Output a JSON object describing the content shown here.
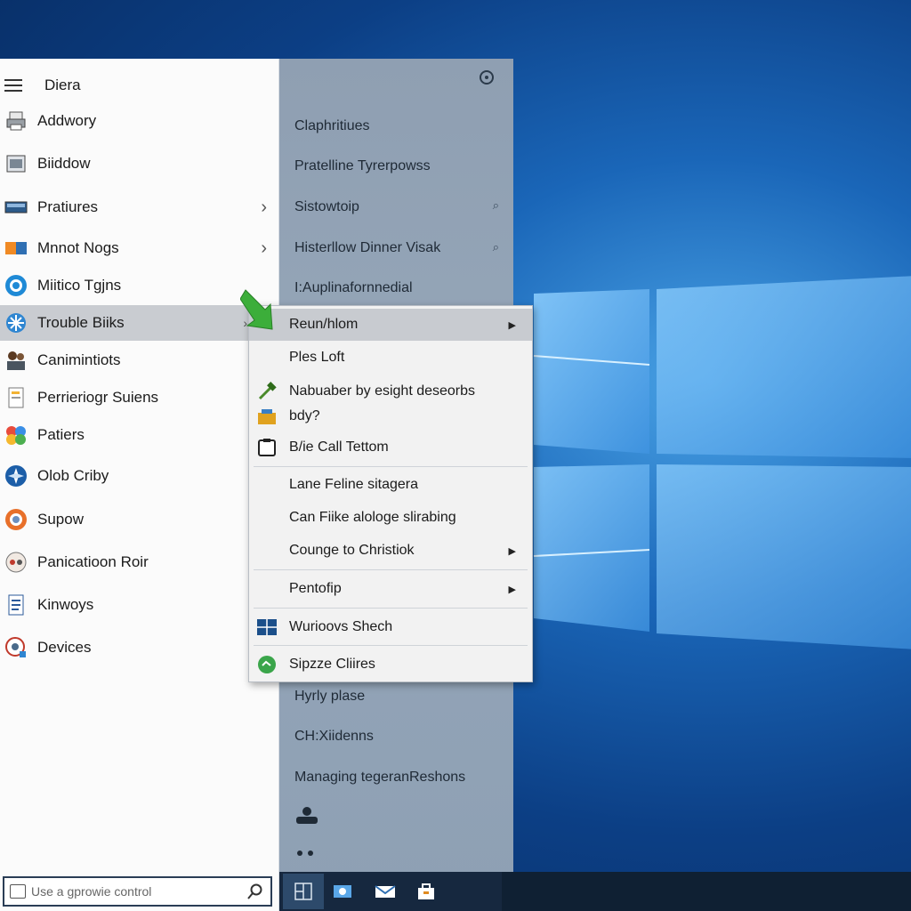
{
  "start_menu": {
    "title": "Diera",
    "items": [
      {
        "label": "Addwory",
        "icon": "printer-icon"
      },
      {
        "label": "Biiddow",
        "icon": "window-icon"
      },
      {
        "label": "Pratiures",
        "icon": "display-icon",
        "chevron": "›"
      },
      {
        "label": "Mnnot Nogs",
        "icon": "folder-icon",
        "chevron": "›"
      },
      {
        "label": "Miitico Tgjns",
        "icon": "globe-icon"
      },
      {
        "label": "Trouble Biiks",
        "icon": "settings-gear-icon",
        "chevron": "›"
      },
      {
        "label": "Canimintiots",
        "icon": "people-icon"
      },
      {
        "label": "Perrieriogr Suiens",
        "icon": "document-icon"
      },
      {
        "label": "Patiers",
        "icon": "shapes-icon"
      },
      {
        "label": "Olob Criby",
        "icon": "compass-icon"
      },
      {
        "label": "Supow",
        "icon": "browser-icon"
      },
      {
        "label": "Panicatioon Roir",
        "icon": "gamepad-icon"
      },
      {
        "label": "Kinwoys",
        "icon": "file-icon"
      },
      {
        "label": "Devices",
        "icon": "devices-icon"
      }
    ]
  },
  "tile_column": {
    "items": [
      {
        "label": "Claphritiues"
      },
      {
        "label": "Pratelline Tyrerpowss"
      },
      {
        "label": "Sistowtoip",
        "pin": "⌕"
      },
      {
        "label": "Histerllow Dinner Visak",
        "pin": "⌕"
      },
      {
        "label": "I:Auplinafornnedial"
      },
      {
        "label": "Hyrly plase"
      },
      {
        "label": "CH:Xiidenns"
      },
      {
        "label": "Managing tegeranReshons"
      }
    ]
  },
  "context_menu": {
    "items": [
      {
        "label": "Reun/hlom",
        "arrow": "▶"
      },
      {
        "label": "Ples Loft"
      },
      {
        "label": "Nabuaber by esight deseorbs"
      },
      {
        "label": "bdy?"
      },
      {
        "label": "B/ie Call Tettom"
      },
      {
        "label": "Lane Feline sitagera"
      },
      {
        "label": "Can Fiike alologe slirabing"
      },
      {
        "label": "Counge to Christiok",
        "arrow": "▶"
      },
      {
        "label": "Pentofip",
        "arrow": "▶"
      },
      {
        "label": "Wurioovs Shech"
      },
      {
        "label": "Sipzze Cliires"
      }
    ]
  },
  "search": {
    "placeholder": "Use a gprowie control"
  },
  "taskbar": {
    "icons": [
      "start-icon",
      "photos-icon",
      "mail-icon",
      "store-icon"
    ]
  },
  "colors": {
    "accent": "#1a66b8",
    "panel": "#fbfbfb",
    "tile_column": "#93a4b6",
    "taskbar": "#16283f"
  }
}
